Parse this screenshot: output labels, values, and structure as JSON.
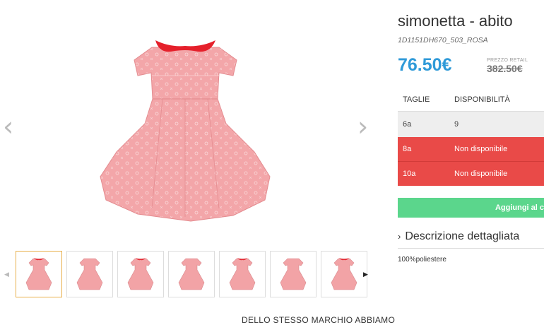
{
  "product": {
    "title": "simonetta - abito",
    "sku": "1D1151DH670_503_ROSA",
    "price": "76.50€",
    "retail_label": "PREZZO RETAIL",
    "retail_price": "382.50€"
  },
  "gallery": {
    "prev_icon": "chevron-left-icon",
    "next_icon": "chevron-right-icon",
    "thumbnail_count": 7
  },
  "sizes": {
    "headers": [
      "TAGLIE",
      "DISPONIBILITÀ"
    ],
    "rows": [
      {
        "size": "6a",
        "availability": "9",
        "status_color": "#eeeeee"
      },
      {
        "size": "8a",
        "availability": "Non disponibile",
        "status_color": "#e94a48"
      },
      {
        "size": "10a",
        "availability": "Non disponibile",
        "status_color": "#e94a48"
      }
    ]
  },
  "cart": {
    "label": "Aggiungi al c",
    "color": "#5bd68c"
  },
  "description": {
    "heading": "Descrizione dettagliata",
    "text": "100%poliestere"
  },
  "footer": {
    "heading": "DELLO STESSO MARCHIO ABBIAMO"
  },
  "colors": {
    "price": "#2f9ad8",
    "accent_red": "#e94a48",
    "collar": "#e5202b",
    "dress": "#f2a3a6"
  }
}
